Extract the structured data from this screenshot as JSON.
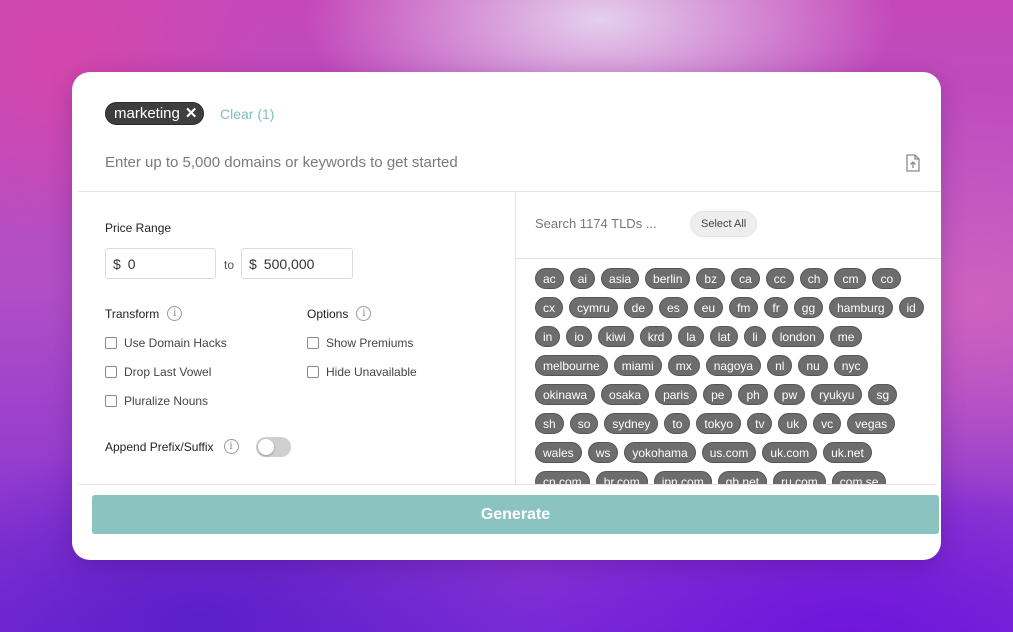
{
  "keywords": {
    "chips": [
      {
        "label": "marketing",
        "remove": "✕"
      }
    ],
    "clear_label": "Clear (1)",
    "input_placeholder": "Enter up to 5,000 domains or keywords to get started"
  },
  "price": {
    "label": "Price Range",
    "currency": "$",
    "min": "0",
    "to_label": "to",
    "max": "500,000"
  },
  "transform": {
    "title": "Transform",
    "options": [
      "Use Domain Hacks",
      "Drop Last Vowel",
      "Pluralize Nouns"
    ]
  },
  "options": {
    "title": "Options",
    "options": [
      "Show Premiums",
      "Hide Unavailable"
    ]
  },
  "append": {
    "label": "Append Prefix/Suffix",
    "enabled": false
  },
  "tld_panel": {
    "search_placeholder": "Search 1174 TLDs ...",
    "select_all": "Select All",
    "tlds": [
      "ac",
      "ai",
      "asia",
      "berlin",
      "bz",
      "ca",
      "cc",
      "ch",
      "cm",
      "co",
      "cx",
      "cymru",
      "de",
      "es",
      "eu",
      "fm",
      "fr",
      "gg",
      "hamburg",
      "id",
      "in",
      "io",
      "kiwi",
      "krd",
      "la",
      "lat",
      "li",
      "london",
      "me",
      "melbourne",
      "miami",
      "mx",
      "nagoya",
      "nl",
      "nu",
      "nyc",
      "okinawa",
      "osaka",
      "paris",
      "pe",
      "ph",
      "pw",
      "ryukyu",
      "sg",
      "sh",
      "so",
      "sydney",
      "to",
      "tokyo",
      "tv",
      "uk",
      "vc",
      "vegas",
      "wales",
      "ws",
      "yokohama",
      "us.com",
      "uk.com",
      "uk.net",
      "cn.com",
      "br.com",
      "jpn.com",
      "gb.net",
      "ru.com",
      "com.se"
    ]
  },
  "generate_label": "Generate",
  "colors": {
    "accent_teal": "#8bc3c1",
    "chip_dark": "#3e3e3e",
    "tld_gray": "#6d6d6d"
  }
}
